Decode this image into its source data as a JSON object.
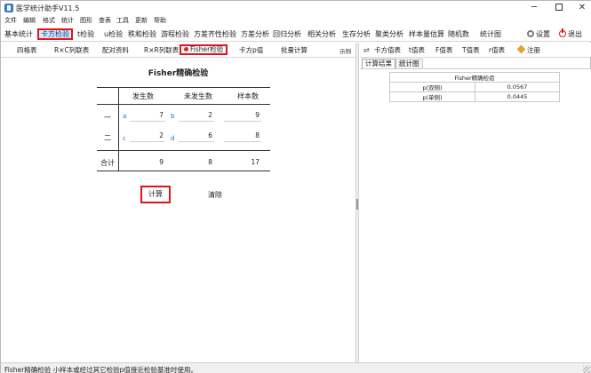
{
  "window": {
    "title": "医学统计助手V11.5",
    "minimize": "─",
    "close": "✕"
  },
  "menu": [
    "文件",
    "编辑",
    "格式",
    "统计",
    "图形",
    "查表",
    "工具",
    "更新",
    "帮助"
  ],
  "toolbar": {
    "items": [
      "基本统计",
      "卡方检验",
      "t检验",
      "u检验",
      "秩和检验",
      "游程检验",
      "方差齐性检验",
      "方差分析",
      "回归分析",
      "相关分析",
      "生存分析",
      "聚类分析",
      "样本量估算",
      "随机数",
      "统计图"
    ],
    "active_index": 1,
    "settings": "设置",
    "exit": "退出"
  },
  "subtabs": {
    "items": [
      "四格表",
      "R×C列联表",
      "配对资料",
      "R×R列联表",
      "Fisher检验",
      "卡方p值",
      "批量计算"
    ],
    "active_index": 4,
    "sample": "示例"
  },
  "fisher": {
    "title": "Fisher精确检验",
    "headers": [
      "发生数",
      "未发生数",
      "样本数"
    ],
    "rows": [
      {
        "label": "一",
        "cells": [
          {
            "letter": "a",
            "value": "7"
          },
          {
            "letter": "b",
            "value": "2"
          }
        ],
        "total": "9"
      },
      {
        "label": "二",
        "cells": [
          {
            "letter": "c",
            "value": "2"
          },
          {
            "letter": "d",
            "value": "6"
          }
        ],
        "total": "8"
      }
    ],
    "total_row": {
      "label": "合计",
      "values": [
        "9",
        "8",
        "17"
      ]
    },
    "calc_button": "计算",
    "clear_button": "清除"
  },
  "right_toolbar": {
    "items": [
      "卡方值表",
      "t值表",
      "F值表",
      "T值表",
      "r值表"
    ],
    "register": "注册"
  },
  "right_tabs": [
    "计算结果",
    "统计图"
  ],
  "result_table": {
    "header": "Fisher精确检验",
    "rows": [
      {
        "label": "p(双侧)",
        "value": "0.0567"
      },
      {
        "label": "p(单侧)",
        "value": "0.0445"
      }
    ]
  },
  "status": {
    "text": "Fisher精确检验    小样本或经过其它检验p值接近检验基准时使用。"
  }
}
